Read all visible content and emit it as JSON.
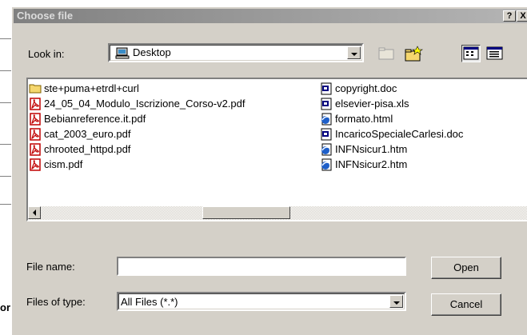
{
  "background": {
    "fragment_text": "or"
  },
  "dialog": {
    "title": "Choose file",
    "help_label": "?",
    "close_label": "X",
    "look_in_label": "Look in:",
    "look_in_value": "Desktop",
    "files_left": [
      {
        "name": "ste+puma+etrdl+curl",
        "icon": "folder-icon"
      },
      {
        "name": "24_05_04_Modulo_Iscrizione_Corso-v2.pdf",
        "icon": "pdf-icon"
      },
      {
        "name": "Bebianreference.it.pdf",
        "icon": "pdf-icon"
      },
      {
        "name": "cat_2003_euro.pdf",
        "icon": "pdf-icon"
      },
      {
        "name": "chrooted_httpd.pdf",
        "icon": "pdf-icon"
      },
      {
        "name": "cism.pdf",
        "icon": "pdf-icon"
      }
    ],
    "files_right": [
      {
        "name": "copyright.doc",
        "icon": "doc-icon"
      },
      {
        "name": "elsevier-pisa.xls",
        "icon": "doc-icon"
      },
      {
        "name": "formato.html",
        "icon": "html-icon"
      },
      {
        "name": "IncaricoSpecialeCarlesi.doc",
        "icon": "doc-icon"
      },
      {
        "name": "INFNsicur1.htm",
        "icon": "html-icon"
      },
      {
        "name": "INFNsicur2.htm",
        "icon": "html-icon"
      }
    ],
    "file_name_label": "File name:",
    "file_name_value": "",
    "file_type_label": "Files of type:",
    "file_type_value": "All Files (*.*)",
    "open_label": "Open",
    "cancel_label": "Cancel"
  }
}
